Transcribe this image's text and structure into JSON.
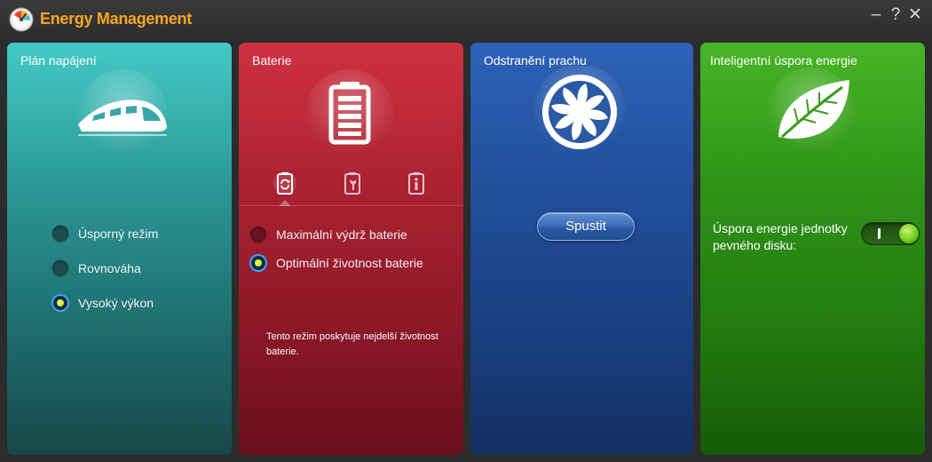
{
  "window": {
    "title": "Energy Management",
    "controls": {
      "minimize": "–",
      "help": "?",
      "close": "✕"
    }
  },
  "panels": {
    "power_plan": {
      "title": "Plán napájení",
      "icon": "train-icon",
      "options": [
        {
          "label": "Úsporný režim",
          "selected": false
        },
        {
          "label": "Rovnováha",
          "selected": false
        },
        {
          "label": "Vysoký výkon",
          "selected": true
        }
      ]
    },
    "battery": {
      "title": "Baterie",
      "icon": "battery-icon",
      "tabs": [
        "battery-refresh-icon",
        "battery-wrench-icon",
        "battery-info-icon"
      ],
      "options": [
        {
          "label": "Maximální výdrž baterie",
          "selected": false
        },
        {
          "label": "Optimální životnost baterie",
          "selected": true
        }
      ],
      "description": "Tento režim poskytuje nejdelší životnost baterie."
    },
    "dust_removal": {
      "title": "Odstranění prachu",
      "icon": "fan-icon",
      "start_label": "Spustit"
    },
    "smart_saving": {
      "title": "Inteligentní úspora energie",
      "icon": "leaf-icon",
      "hdd_label": "Úspora energie jednotky pevného disku:",
      "hdd_toggle_on": true
    }
  },
  "colors": {
    "title_accent": "#f5a623",
    "teal": "#2a9896",
    "red": "#ab2231",
    "blue": "#21509b",
    "green": "#2e9318"
  }
}
